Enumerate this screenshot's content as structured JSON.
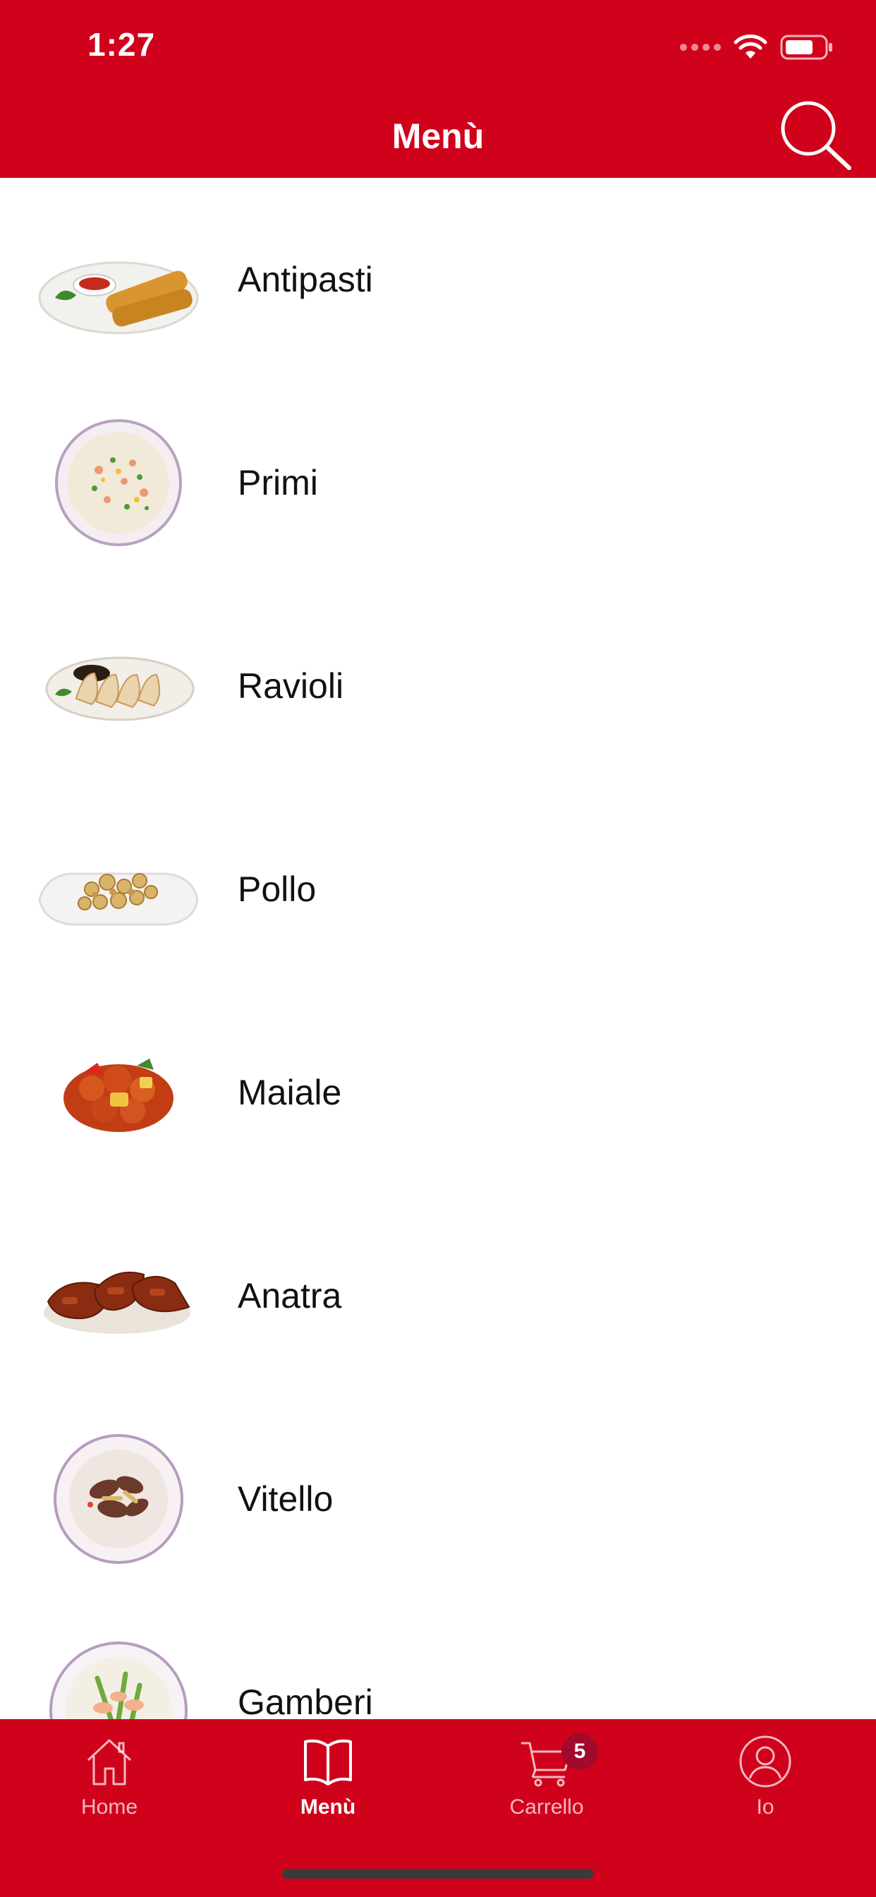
{
  "status_bar": {
    "time": "1:27"
  },
  "header": {
    "title": "Menù",
    "search_icon": "search-icon",
    "background_color": "#d0021b"
  },
  "categories": [
    {
      "label": "Antipasti",
      "icon": "spring-rolls-dish-icon"
    },
    {
      "label": "Primi",
      "icon": "fried-rice-plate-icon"
    },
    {
      "label": "Ravioli",
      "icon": "dumplings-dish-icon"
    },
    {
      "label": "Pollo",
      "icon": "chicken-dish-icon"
    },
    {
      "label": "Maiale",
      "icon": "sweet-sour-pork-icon"
    },
    {
      "label": "Anatra",
      "icon": "roast-duck-icon"
    },
    {
      "label": "Vitello",
      "icon": "beef-plate-icon"
    },
    {
      "label": "Gamberi",
      "icon": "shrimp-plate-icon"
    }
  ],
  "tab_bar": {
    "tabs": [
      {
        "label": "Home",
        "icon": "home-icon",
        "active": false
      },
      {
        "label": "Menù",
        "icon": "book-icon",
        "active": true
      },
      {
        "label": "Carrello",
        "icon": "cart-icon",
        "active": false
      },
      {
        "label": "Io",
        "icon": "user-icon",
        "active": false
      }
    ],
    "cart_badge": "5",
    "background_color": "#d0021b"
  }
}
